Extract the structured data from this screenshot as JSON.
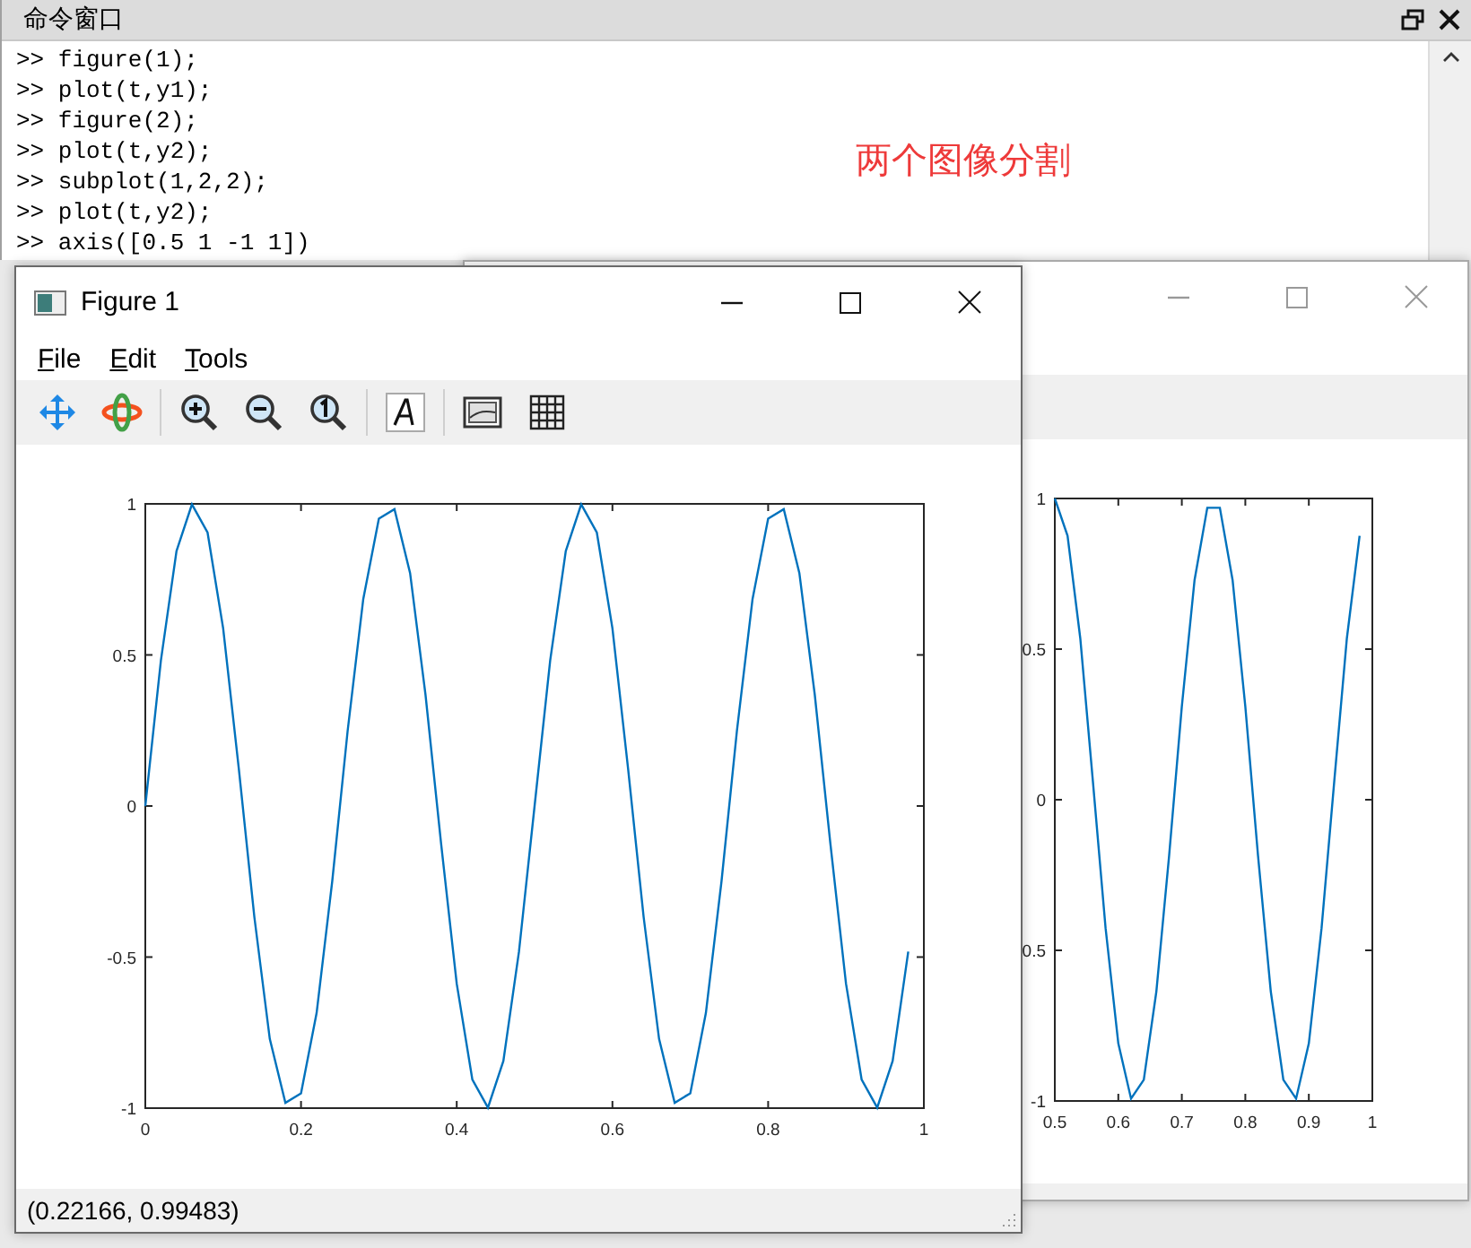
{
  "command_window": {
    "title": "命令窗口",
    "lines": [
      ">> figure(1);",
      ">> plot(t,y1);",
      ">> figure(2);",
      ">> plot(t,y2);",
      ">> subplot(1,2,2);",
      ">> plot(t,y2);",
      ">> axis([0.5 1 -1 1])"
    ]
  },
  "annotation": "两个图像分割",
  "figures": [
    {
      "title": "Figure 1",
      "active": true,
      "menu": [
        "File",
        "Edit",
        "Tools"
      ],
      "status": "(0.22166, 0.99483)",
      "chart_data": {
        "type": "line",
        "x": [
          0,
          0.02,
          0.04,
          0.06,
          0.08,
          0.1,
          0.12,
          0.14,
          0.16,
          0.18,
          0.2,
          0.22,
          0.24,
          0.26,
          0.28,
          0.3,
          0.32,
          0.34,
          0.36,
          0.38,
          0.4,
          0.42,
          0.44,
          0.46,
          0.48,
          0.5,
          0.52,
          0.54,
          0.56,
          0.58,
          0.6,
          0.62,
          0.64,
          0.66,
          0.68,
          0.7,
          0.72,
          0.74,
          0.76,
          0.78,
          0.8,
          0.82,
          0.84,
          0.86,
          0.88,
          0.9,
          0.92,
          0.94,
          0.96,
          0.98
        ],
        "series": [
          {
            "color": "#0072bd",
            "values": [
              0,
              0.482,
              0.844,
              0.998,
              0.905,
              0.588,
              0.125,
              -0.368,
              -0.771,
              -0.982,
              -0.951,
              -0.685,
              -0.249,
              0.249,
              0.685,
              0.951,
              0.982,
              0.771,
              0.368,
              -0.125,
              -0.588,
              -0.905,
              -0.998,
              -0.844,
              -0.482,
              0,
              0.482,
              0.844,
              0.998,
              0.905,
              0.588,
              0.125,
              -0.368,
              -0.771,
              -0.982,
              -0.951,
              -0.685,
              -0.249,
              0.249,
              0.685,
              0.951,
              0.982,
              0.771,
              0.368,
              -0.125,
              -0.588,
              -0.905,
              -0.998,
              -0.844,
              -0.482
            ]
          }
        ],
        "xlim": [
          0,
          1
        ],
        "ylim": [
          -1,
          1
        ],
        "xticks": [
          0,
          0.2,
          0.4,
          0.6,
          0.8,
          1
        ],
        "yticks": [
          -1,
          -0.5,
          0,
          0.5,
          1
        ]
      }
    },
    {
      "active": false,
      "chart_data": {
        "type": "line",
        "x": [
          0.5,
          0.52,
          0.54,
          0.56,
          0.58,
          0.6,
          0.62,
          0.64,
          0.66,
          0.68,
          0.7,
          0.72,
          0.74,
          0.76,
          0.78,
          0.8,
          0.82,
          0.84,
          0.86,
          0.88,
          0.9,
          0.92,
          0.94,
          0.96,
          0.98
        ],
        "series": [
          {
            "color": "#0072bd",
            "values": [
              1,
              0.876,
              0.536,
              0.063,
              -0.426,
              -0.809,
              -0.992,
              -0.93,
              -0.637,
              -0.187,
              0.309,
              0.729,
              0.969,
              0.969,
              0.729,
              0.309,
              -0.187,
              -0.637,
              -0.93,
              -0.992,
              -0.809,
              -0.426,
              0.063,
              0.536,
              0.876
            ]
          }
        ],
        "xlim": [
          0.5,
          1
        ],
        "ylim": [
          -1,
          1
        ],
        "xticks": [
          0.5,
          0.6,
          0.7,
          0.8,
          0.9,
          1
        ],
        "yticks": [
          -1,
          {
            "value": -0.5,
            "label": "0.5"
          },
          0,
          0.5,
          1
        ]
      }
    }
  ]
}
